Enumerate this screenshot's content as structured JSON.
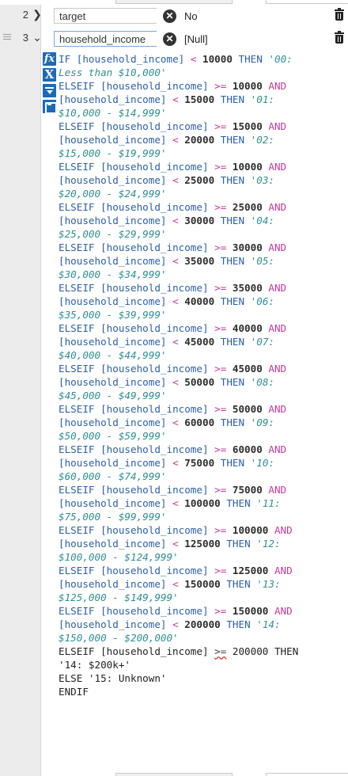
{
  "rows": [
    {
      "number": "2",
      "field": "target",
      "value": "No",
      "expanded": false
    },
    {
      "number": "3",
      "field": "household_income",
      "value": "[Null]",
      "expanded": true
    }
  ],
  "tools": {
    "function": "fx",
    "variable": "X"
  },
  "formula_lines": [
    [
      [
        "kw",
        "IF "
      ],
      [
        "pl",
        "[household_income] "
      ],
      [
        "op",
        "< "
      ],
      [
        "nm",
        "10000"
      ],
      [
        "kw",
        " THEN "
      ],
      [
        "st",
        "'00:"
      ]
    ],
    [
      [
        "st",
        "Less than $10,000'"
      ]
    ],
    [
      [
        "kw",
        "ELSEIF "
      ],
      [
        "pl",
        "[household_income] "
      ],
      [
        "op",
        ">= "
      ],
      [
        "nm",
        "10000"
      ],
      [
        "op",
        " AND"
      ]
    ],
    [
      [
        "pl",
        "[household_income] "
      ],
      [
        "op",
        "< "
      ],
      [
        "nm",
        "15000"
      ],
      [
        "kw",
        " THEN "
      ],
      [
        "st",
        "'01:"
      ]
    ],
    [
      [
        "st",
        "$10,000 - $14,999'"
      ]
    ],
    [
      [
        "kw",
        "ELSEIF "
      ],
      [
        "pl",
        "[household_income] "
      ],
      [
        "op",
        ">= "
      ],
      [
        "nm",
        "15000"
      ],
      [
        "op",
        " AND"
      ]
    ],
    [
      [
        "pl",
        "[household_income] "
      ],
      [
        "op",
        "< "
      ],
      [
        "nm",
        "20000"
      ],
      [
        "kw",
        " THEN "
      ],
      [
        "st",
        "'02:"
      ]
    ],
    [
      [
        "st",
        "$15,000 - $19,999'"
      ]
    ],
    [
      [
        "kw",
        "ELSEIF "
      ],
      [
        "pl",
        "[household_income] "
      ],
      [
        "op",
        ">= "
      ],
      [
        "nm",
        "10000"
      ],
      [
        "op",
        " AND"
      ]
    ],
    [
      [
        "pl",
        "[household_income] "
      ],
      [
        "op",
        "< "
      ],
      [
        "nm",
        "25000"
      ],
      [
        "kw",
        " THEN "
      ],
      [
        "st",
        "'03:"
      ]
    ],
    [
      [
        "st",
        "$20,000 - $24,999'"
      ]
    ],
    [
      [
        "kw",
        "ELSEIF "
      ],
      [
        "pl",
        "[household_income] "
      ],
      [
        "op",
        ">= "
      ],
      [
        "nm",
        "25000"
      ],
      [
        "op",
        " AND"
      ]
    ],
    [
      [
        "pl",
        "[household_income] "
      ],
      [
        "op",
        "< "
      ],
      [
        "nm",
        "30000"
      ],
      [
        "kw",
        " THEN "
      ],
      [
        "st",
        "'04:"
      ]
    ],
    [
      [
        "st",
        "$25,000 - $29,999'"
      ]
    ],
    [
      [
        "kw",
        "ELSEIF "
      ],
      [
        "pl",
        "[household_income] "
      ],
      [
        "op",
        ">= "
      ],
      [
        "nm",
        "30000"
      ],
      [
        "op",
        " AND"
      ]
    ],
    [
      [
        "pl",
        "[household_income] "
      ],
      [
        "op",
        "< "
      ],
      [
        "nm",
        "35000"
      ],
      [
        "kw",
        " THEN "
      ],
      [
        "st",
        "'05:"
      ]
    ],
    [
      [
        "st",
        "$30,000 - $34,999'"
      ]
    ],
    [
      [
        "kw",
        "ELSEIF "
      ],
      [
        "pl",
        "[household_income] "
      ],
      [
        "op",
        ">= "
      ],
      [
        "nm",
        "35000"
      ],
      [
        "op",
        " AND"
      ]
    ],
    [
      [
        "pl",
        "[household_income] "
      ],
      [
        "op",
        "< "
      ],
      [
        "nm",
        "40000"
      ],
      [
        "kw",
        " THEN "
      ],
      [
        "st",
        "'06:"
      ]
    ],
    [
      [
        "st",
        "$35,000 - $39,999'"
      ]
    ],
    [
      [
        "kw",
        "ELSEIF "
      ],
      [
        "pl",
        "[household_income] "
      ],
      [
        "op",
        ">= "
      ],
      [
        "nm",
        "40000"
      ],
      [
        "op",
        " AND"
      ]
    ],
    [
      [
        "pl",
        "[household_income] "
      ],
      [
        "op",
        "< "
      ],
      [
        "nm",
        "45000"
      ],
      [
        "kw",
        " THEN "
      ],
      [
        "st",
        "'07:"
      ]
    ],
    [
      [
        "st",
        "$40,000 - $44,999'"
      ]
    ],
    [
      [
        "kw",
        "ELSEIF "
      ],
      [
        "pl",
        "[household_income] "
      ],
      [
        "op",
        ">= "
      ],
      [
        "nm",
        "45000"
      ],
      [
        "op",
        " AND"
      ]
    ],
    [
      [
        "pl",
        "[household_income] "
      ],
      [
        "op",
        "< "
      ],
      [
        "nm",
        "50000"
      ],
      [
        "kw",
        " THEN "
      ],
      [
        "st",
        "'08:"
      ]
    ],
    [
      [
        "st",
        "$45,000 - $49,999'"
      ]
    ],
    [
      [
        "kw",
        "ELSEIF "
      ],
      [
        "pl",
        "[household_income] "
      ],
      [
        "op",
        ">= "
      ],
      [
        "nm",
        "50000"
      ],
      [
        "op",
        " AND"
      ]
    ],
    [
      [
        "pl",
        "[household_income] "
      ],
      [
        "op",
        "< "
      ],
      [
        "nm",
        "60000"
      ],
      [
        "kw",
        " THEN "
      ],
      [
        "st",
        "'09:"
      ]
    ],
    [
      [
        "st",
        "$50,000 - $59,999'"
      ]
    ],
    [
      [
        "kw",
        "ELSEIF "
      ],
      [
        "pl",
        "[household_income] "
      ],
      [
        "op",
        ">= "
      ],
      [
        "nm",
        "60000"
      ],
      [
        "op",
        " AND"
      ]
    ],
    [
      [
        "pl",
        "[household_income] "
      ],
      [
        "op",
        "< "
      ],
      [
        "nm",
        "75000"
      ],
      [
        "kw",
        " THEN "
      ],
      [
        "st",
        "'10:"
      ]
    ],
    [
      [
        "st",
        "$60,000 - $74,999'"
      ]
    ],
    [
      [
        "kw",
        "ELSEIF "
      ],
      [
        "pl",
        "[household_income] "
      ],
      [
        "op",
        ">= "
      ],
      [
        "nm",
        "75000"
      ],
      [
        "op",
        " AND"
      ]
    ],
    [
      [
        "pl",
        "[household_income] "
      ],
      [
        "op",
        "< "
      ],
      [
        "nm",
        "100000"
      ],
      [
        "kw",
        " THEN "
      ],
      [
        "st",
        "'11:"
      ]
    ],
    [
      [
        "st",
        "$75,000 - $99,999'"
      ]
    ],
    [
      [
        "kw",
        "ELSEIF "
      ],
      [
        "pl",
        "[household_income] "
      ],
      [
        "op",
        ">= "
      ],
      [
        "nm",
        "100000"
      ],
      [
        "op",
        " AND"
      ]
    ],
    [
      [
        "pl",
        "[household_income] "
      ],
      [
        "op",
        "< "
      ],
      [
        "nm",
        "125000"
      ],
      [
        "kw",
        " THEN "
      ],
      [
        "st",
        "'12:"
      ]
    ],
    [
      [
        "st",
        "$100,000 - $124,999'"
      ]
    ],
    [
      [
        "kw",
        "ELSEIF "
      ],
      [
        "pl",
        "[household_income] "
      ],
      [
        "op",
        ">= "
      ],
      [
        "nm",
        "125000"
      ],
      [
        "op",
        " AND"
      ]
    ],
    [
      [
        "pl",
        "[household_income] "
      ],
      [
        "op",
        "< "
      ],
      [
        "nm",
        "150000"
      ],
      [
        "kw",
        " THEN "
      ],
      [
        "st",
        "'13:"
      ]
    ],
    [
      [
        "st",
        "$125,000 - $149,999'"
      ]
    ],
    [
      [
        "kw",
        "ELSEIF "
      ],
      [
        "pl",
        "[household_income] "
      ],
      [
        "op",
        ">= "
      ],
      [
        "nm",
        "150000"
      ],
      [
        "op",
        " AND"
      ]
    ],
    [
      [
        "pl",
        "[household_income] "
      ],
      [
        "op",
        "< "
      ],
      [
        "nm",
        "200000"
      ],
      [
        "kw",
        " THEN "
      ],
      [
        "st",
        "'14:"
      ]
    ],
    [
      [
        "st",
        "$150,000 - $200,000'"
      ]
    ],
    [
      [
        "blk",
        "ELSEIF [household_income] "
      ],
      [
        "squig",
        ">="
      ],
      [
        "blk",
        " 200000 THEN"
      ]
    ],
    [
      [
        "blk",
        "'14: $200k+'"
      ]
    ],
    [
      [
        "blk",
        "ELSE '15: Unknown'"
      ]
    ],
    [
      [
        "blk",
        "ENDIF"
      ]
    ]
  ],
  "colors": {
    "keyword": "#2c5fa8",
    "number": "#2c2c2c",
    "operator": "#c83a9a",
    "string": "#2f8f8f",
    "tool_button": "#1c6bb8"
  }
}
